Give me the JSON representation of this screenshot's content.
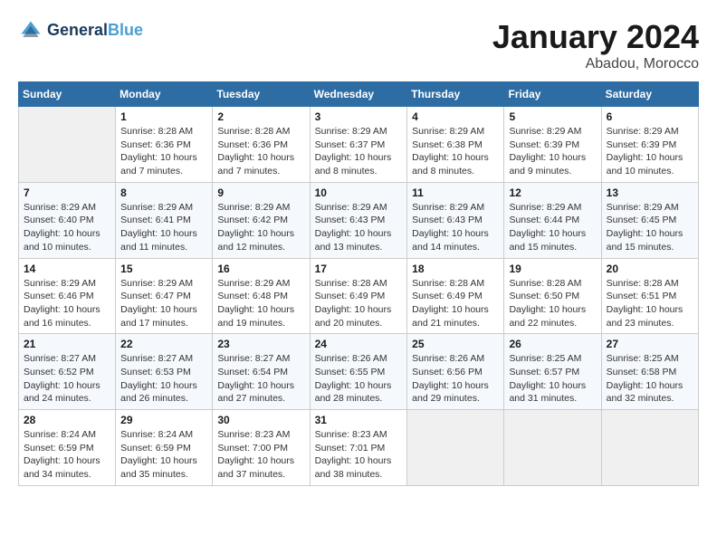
{
  "header": {
    "logo_line1": "General",
    "logo_line2": "Blue",
    "month": "January 2024",
    "location": "Abadou, Morocco"
  },
  "weekdays": [
    "Sunday",
    "Monday",
    "Tuesday",
    "Wednesday",
    "Thursday",
    "Friday",
    "Saturday"
  ],
  "weeks": [
    [
      {
        "num": "",
        "sunrise": "",
        "sunset": "",
        "daylight": ""
      },
      {
        "num": "1",
        "sunrise": "Sunrise: 8:28 AM",
        "sunset": "Sunset: 6:36 PM",
        "daylight": "Daylight: 10 hours and 7 minutes."
      },
      {
        "num": "2",
        "sunrise": "Sunrise: 8:28 AM",
        "sunset": "Sunset: 6:36 PM",
        "daylight": "Daylight: 10 hours and 7 minutes."
      },
      {
        "num": "3",
        "sunrise": "Sunrise: 8:29 AM",
        "sunset": "Sunset: 6:37 PM",
        "daylight": "Daylight: 10 hours and 8 minutes."
      },
      {
        "num": "4",
        "sunrise": "Sunrise: 8:29 AM",
        "sunset": "Sunset: 6:38 PM",
        "daylight": "Daylight: 10 hours and 8 minutes."
      },
      {
        "num": "5",
        "sunrise": "Sunrise: 8:29 AM",
        "sunset": "Sunset: 6:39 PM",
        "daylight": "Daylight: 10 hours and 9 minutes."
      },
      {
        "num": "6",
        "sunrise": "Sunrise: 8:29 AM",
        "sunset": "Sunset: 6:39 PM",
        "daylight": "Daylight: 10 hours and 10 minutes."
      }
    ],
    [
      {
        "num": "7",
        "sunrise": "Sunrise: 8:29 AM",
        "sunset": "Sunset: 6:40 PM",
        "daylight": "Daylight: 10 hours and 10 minutes."
      },
      {
        "num": "8",
        "sunrise": "Sunrise: 8:29 AM",
        "sunset": "Sunset: 6:41 PM",
        "daylight": "Daylight: 10 hours and 11 minutes."
      },
      {
        "num": "9",
        "sunrise": "Sunrise: 8:29 AM",
        "sunset": "Sunset: 6:42 PM",
        "daylight": "Daylight: 10 hours and 12 minutes."
      },
      {
        "num": "10",
        "sunrise": "Sunrise: 8:29 AM",
        "sunset": "Sunset: 6:43 PM",
        "daylight": "Daylight: 10 hours and 13 minutes."
      },
      {
        "num": "11",
        "sunrise": "Sunrise: 8:29 AM",
        "sunset": "Sunset: 6:43 PM",
        "daylight": "Daylight: 10 hours and 14 minutes."
      },
      {
        "num": "12",
        "sunrise": "Sunrise: 8:29 AM",
        "sunset": "Sunset: 6:44 PM",
        "daylight": "Daylight: 10 hours and 15 minutes."
      },
      {
        "num": "13",
        "sunrise": "Sunrise: 8:29 AM",
        "sunset": "Sunset: 6:45 PM",
        "daylight": "Daylight: 10 hours and 15 minutes."
      }
    ],
    [
      {
        "num": "14",
        "sunrise": "Sunrise: 8:29 AM",
        "sunset": "Sunset: 6:46 PM",
        "daylight": "Daylight: 10 hours and 16 minutes."
      },
      {
        "num": "15",
        "sunrise": "Sunrise: 8:29 AM",
        "sunset": "Sunset: 6:47 PM",
        "daylight": "Daylight: 10 hours and 17 minutes."
      },
      {
        "num": "16",
        "sunrise": "Sunrise: 8:29 AM",
        "sunset": "Sunset: 6:48 PM",
        "daylight": "Daylight: 10 hours and 19 minutes."
      },
      {
        "num": "17",
        "sunrise": "Sunrise: 8:28 AM",
        "sunset": "Sunset: 6:49 PM",
        "daylight": "Daylight: 10 hours and 20 minutes."
      },
      {
        "num": "18",
        "sunrise": "Sunrise: 8:28 AM",
        "sunset": "Sunset: 6:49 PM",
        "daylight": "Daylight: 10 hours and 21 minutes."
      },
      {
        "num": "19",
        "sunrise": "Sunrise: 8:28 AM",
        "sunset": "Sunset: 6:50 PM",
        "daylight": "Daylight: 10 hours and 22 minutes."
      },
      {
        "num": "20",
        "sunrise": "Sunrise: 8:28 AM",
        "sunset": "Sunset: 6:51 PM",
        "daylight": "Daylight: 10 hours and 23 minutes."
      }
    ],
    [
      {
        "num": "21",
        "sunrise": "Sunrise: 8:27 AM",
        "sunset": "Sunset: 6:52 PM",
        "daylight": "Daylight: 10 hours and 24 minutes."
      },
      {
        "num": "22",
        "sunrise": "Sunrise: 8:27 AM",
        "sunset": "Sunset: 6:53 PM",
        "daylight": "Daylight: 10 hours and 26 minutes."
      },
      {
        "num": "23",
        "sunrise": "Sunrise: 8:27 AM",
        "sunset": "Sunset: 6:54 PM",
        "daylight": "Daylight: 10 hours and 27 minutes."
      },
      {
        "num": "24",
        "sunrise": "Sunrise: 8:26 AM",
        "sunset": "Sunset: 6:55 PM",
        "daylight": "Daylight: 10 hours and 28 minutes."
      },
      {
        "num": "25",
        "sunrise": "Sunrise: 8:26 AM",
        "sunset": "Sunset: 6:56 PM",
        "daylight": "Daylight: 10 hours and 29 minutes."
      },
      {
        "num": "26",
        "sunrise": "Sunrise: 8:25 AM",
        "sunset": "Sunset: 6:57 PM",
        "daylight": "Daylight: 10 hours and 31 minutes."
      },
      {
        "num": "27",
        "sunrise": "Sunrise: 8:25 AM",
        "sunset": "Sunset: 6:58 PM",
        "daylight": "Daylight: 10 hours and 32 minutes."
      }
    ],
    [
      {
        "num": "28",
        "sunrise": "Sunrise: 8:24 AM",
        "sunset": "Sunset: 6:59 PM",
        "daylight": "Daylight: 10 hours and 34 minutes."
      },
      {
        "num": "29",
        "sunrise": "Sunrise: 8:24 AM",
        "sunset": "Sunset: 6:59 PM",
        "daylight": "Daylight: 10 hours and 35 minutes."
      },
      {
        "num": "30",
        "sunrise": "Sunrise: 8:23 AM",
        "sunset": "Sunset: 7:00 PM",
        "daylight": "Daylight: 10 hours and 37 minutes."
      },
      {
        "num": "31",
        "sunrise": "Sunrise: 8:23 AM",
        "sunset": "Sunset: 7:01 PM",
        "daylight": "Daylight: 10 hours and 38 minutes."
      },
      {
        "num": "",
        "sunrise": "",
        "sunset": "",
        "daylight": ""
      },
      {
        "num": "",
        "sunrise": "",
        "sunset": "",
        "daylight": ""
      },
      {
        "num": "",
        "sunrise": "",
        "sunset": "",
        "daylight": ""
      }
    ]
  ]
}
